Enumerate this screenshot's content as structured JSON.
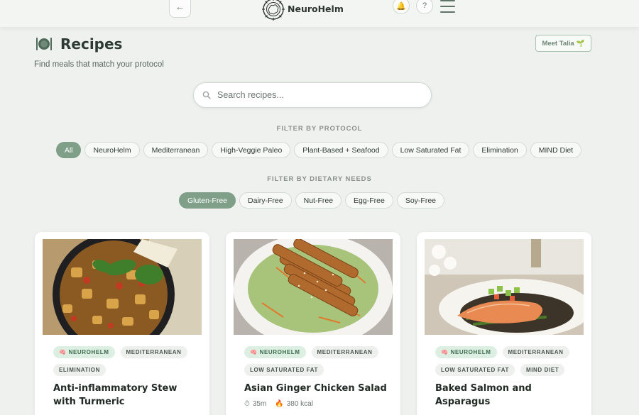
{
  "header": {
    "brand_name": "NeuroHelm",
    "back_icon": "arrow-left-icon",
    "bell_icon": "bell-icon",
    "help_label": "?",
    "menu_icon": "hamburger-menu-icon"
  },
  "page": {
    "title": "Recipes",
    "subtitle": "Find meals that match your protocol",
    "meet_button": "Meet Talia",
    "meet_icon": "sprout-icon"
  },
  "search": {
    "placeholder": "Search recipes..."
  },
  "filters": {
    "protocol_label": "FILTER BY PROTOCOL",
    "protocol": [
      "All",
      "NeuroHelm",
      "Mediterranean",
      "High-Veggie Paleo",
      "Plant-Based + Seafood",
      "Low Saturated Fat",
      "Elimination",
      "MIND Diet"
    ],
    "protocol_selected": "All",
    "dietary_label": "FILTER BY DIETARY NEEDS",
    "dietary": [
      "Gluten-Free",
      "Dairy-Free",
      "Nut-Free",
      "Egg-Free",
      "Soy-Free"
    ],
    "dietary_selected": "Gluten-Free"
  },
  "recipes": [
    {
      "title": "Anti-inflammatory Stew with Turmeric",
      "tags": [
        "NEUROHELM",
        "MEDITERRANEAN",
        "ELIMINATION"
      ],
      "time": "",
      "calories": ""
    },
    {
      "title": "Asian Ginger Chicken Salad",
      "tags": [
        "NEUROHELM",
        "MEDITERRANEAN",
        "LOW SATURATED FAT"
      ],
      "time": "35m",
      "calories": "380 kcal"
    },
    {
      "title": "Baked Salmon and Asparagus",
      "tags": [
        "NEUROHELM",
        "MEDITERRANEAN",
        "LOW SATURATED FAT",
        "MIND DIET"
      ],
      "time": "",
      "calories": ""
    }
  ],
  "colors": {
    "accent": "#7f9f89",
    "background": "#eef1ee",
    "neuro_tag_bg": "#dcefe2"
  }
}
